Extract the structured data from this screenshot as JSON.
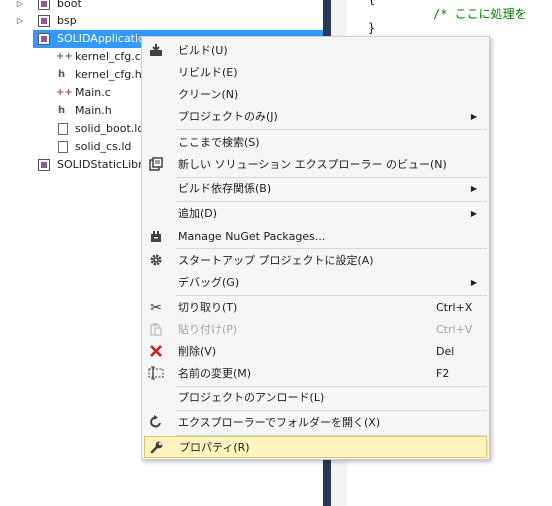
{
  "explorer": {
    "items": [
      {
        "label": "boot",
        "kind": "project",
        "expanded": false
      },
      {
        "label": "bsp",
        "kind": "project",
        "expanded": false
      },
      {
        "label": "SOLIDApplication",
        "kind": "project",
        "expanded": true,
        "selected": true
      },
      {
        "label": "kernel_cfg.c",
        "kind": "cpp"
      },
      {
        "label": "kernel_cfg.h",
        "kind": "header"
      },
      {
        "label": "Main.c",
        "kind": "cpp"
      },
      {
        "label": "Main.h",
        "kind": "header"
      },
      {
        "label": "solid_boot.ld",
        "kind": "file"
      },
      {
        "label": "solid_cs.ld",
        "kind": "file"
      },
      {
        "label": "SOLIDStaticLibrary",
        "kind": "project"
      }
    ]
  },
  "editor": {
    "lines": [
      {
        "text": "{",
        "color": "#1e1e1e"
      },
      {
        "text": "/* ここに処理を",
        "color": "#008000"
      },
      {
        "text": "}",
        "color": "#1e1e1e"
      }
    ]
  },
  "context_menu": {
    "items": [
      {
        "label": "ビルド(U)",
        "icon": "build-icon"
      },
      {
        "label": "リビルド(E)"
      },
      {
        "label": "クリーン(N)"
      },
      {
        "label": "プロジェクトのみ(J)",
        "submenu": true
      },
      {
        "label": "ここまで検索(S)"
      },
      {
        "label": "新しい ソリューション エクスプローラー のビュー(N)",
        "icon": "new-view-icon"
      },
      {
        "label": "ビルド依存関係(B)",
        "submenu": true
      },
      {
        "label": "追加(D)",
        "submenu": true
      },
      {
        "label": "Manage NuGet Packages...",
        "icon": "nuget-icon"
      },
      {
        "label": "スタートアップ プロジェクトに設定(A)",
        "icon": "gear-icon"
      },
      {
        "label": "デバッグ(G)",
        "submenu": true
      },
      {
        "label": "切り取り(T)",
        "icon": "scissors-icon",
        "shortcut": "Ctrl+X"
      },
      {
        "label": "貼り付け(P)",
        "icon": "paste-icon",
        "shortcut": "Ctrl+V",
        "disabled": true
      },
      {
        "label": "削除(V)",
        "icon": "delete-icon",
        "shortcut": "Del"
      },
      {
        "label": "名前の変更(M)",
        "icon": "rename-icon",
        "shortcut": "F2"
      },
      {
        "label": "プロジェクトのアンロード(L)"
      },
      {
        "label": "エクスプローラーでフォルダーを開く(X)",
        "icon": "open-folder-icon"
      },
      {
        "label": "プロパティ(R)",
        "icon": "wrench-icon",
        "highlighted": true
      }
    ]
  }
}
